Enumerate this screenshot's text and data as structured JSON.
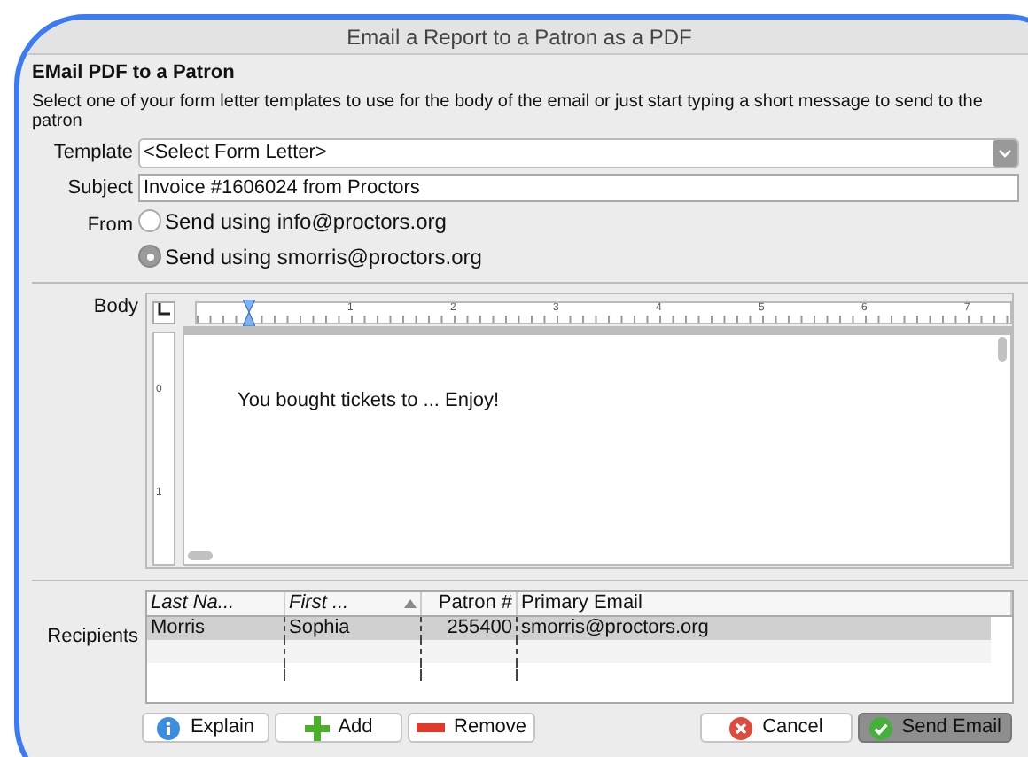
{
  "window": {
    "title": "Email a Report to a Patron as a PDF"
  },
  "heading": "EMail PDF to a Patron",
  "description": "Select one of your form letter templates to use for the body of the email or just start typing a short message to send to the patron",
  "template": {
    "label": "Template",
    "value": "<Select Form Letter>"
  },
  "subject": {
    "label": "Subject",
    "value": "Invoice #1606024 from Proctors"
  },
  "from": {
    "label": "From",
    "options": [
      {
        "label": "Send using info@proctors.org",
        "selected": false
      },
      {
        "label": "Send using smorris@proctors.org",
        "selected": true
      }
    ]
  },
  "body": {
    "label": "Body",
    "ruler_marks": [
      "1",
      "2",
      "3",
      "4",
      "5",
      "6",
      "7"
    ],
    "vertical_ruler_marks": [
      "0",
      "1"
    ],
    "text": "You bought tickets to ... Enjoy!"
  },
  "recipients": {
    "label": "Recipients",
    "columns": [
      {
        "label": "Last Na...",
        "sorted": false
      },
      {
        "label": "First ...",
        "sorted": true
      },
      {
        "label": "Patron #",
        "sorted": false
      },
      {
        "label": "Primary Email",
        "sorted": false
      }
    ],
    "rows": [
      {
        "cells": [
          "Morris",
          "Sophia",
          "255400",
          "smorris@proctors.org"
        ],
        "selected": true
      }
    ]
  },
  "buttons": [
    {
      "label": "Explain",
      "kind": "help"
    },
    {
      "label": "Add",
      "kind": "add"
    },
    {
      "label": "Remove",
      "kind": "remove"
    },
    {
      "label": "Cancel",
      "kind": "cancel"
    },
    {
      "label": "Send Email",
      "kind": "send"
    }
  ]
}
